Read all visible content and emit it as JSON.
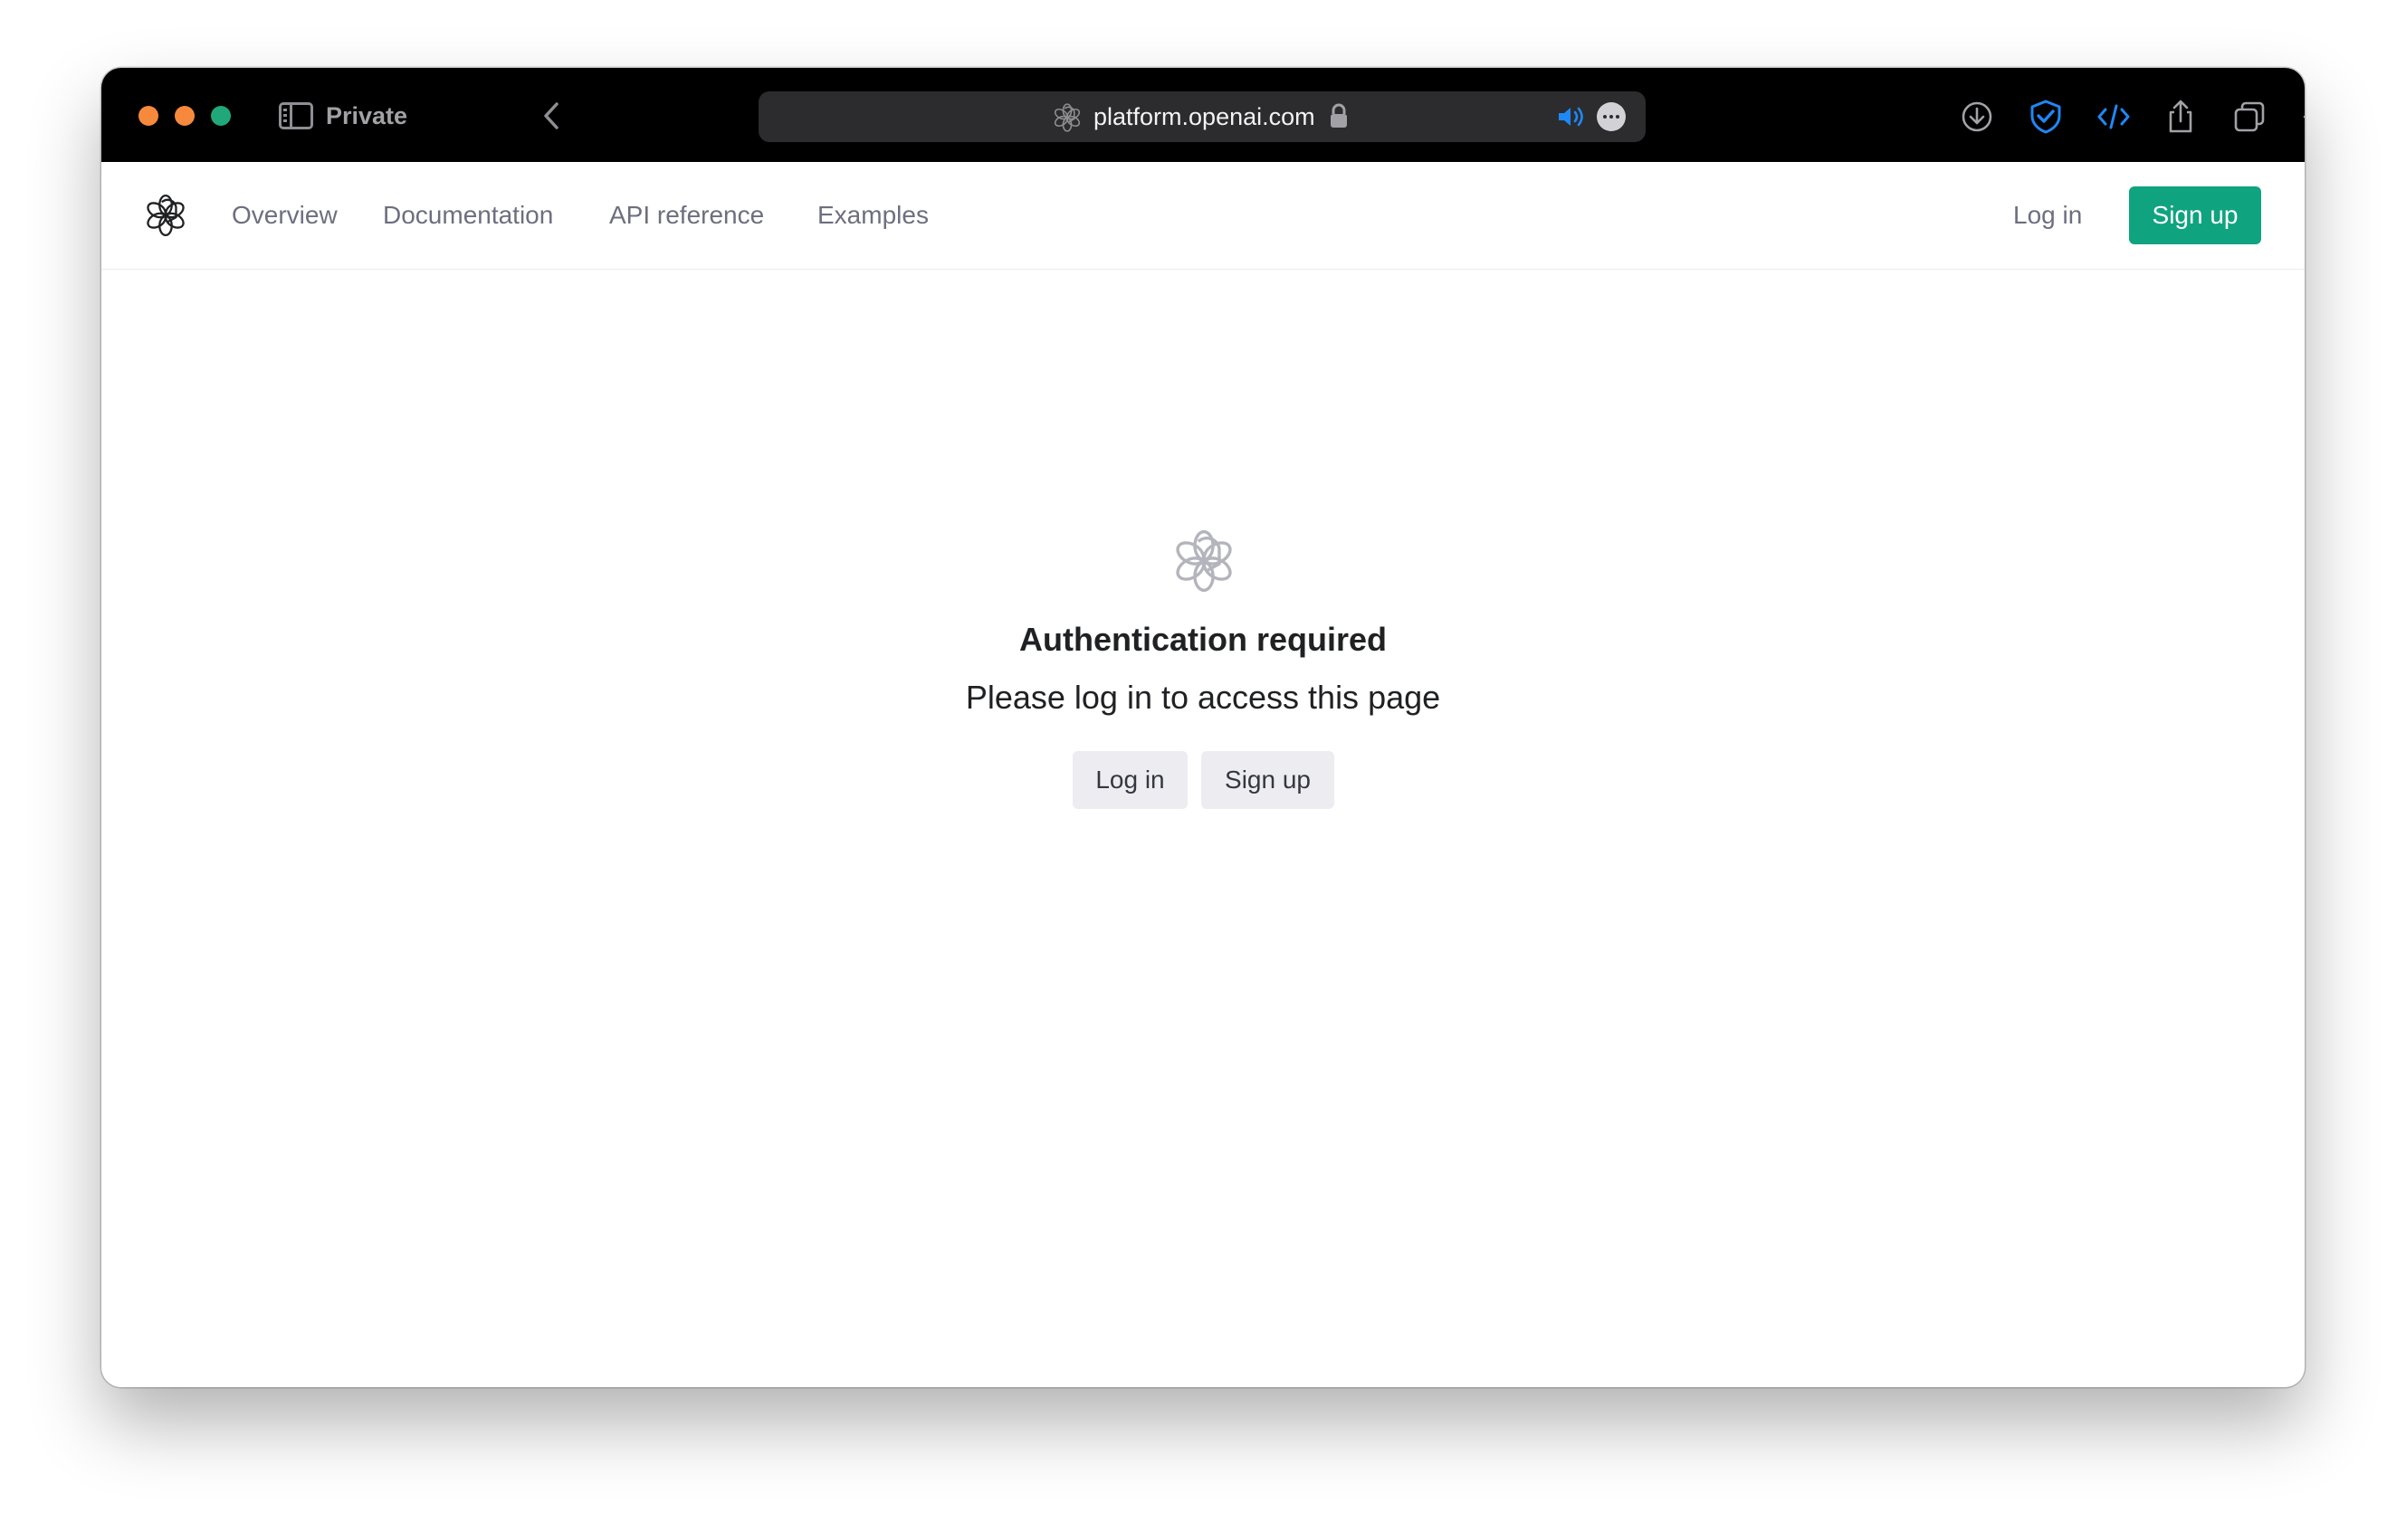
{
  "browser": {
    "mode_label": "Private",
    "url": "platform.openai.com",
    "colors": {
      "close": "#f7893c",
      "minimize": "#f7893c",
      "maximize": "#21a87a",
      "shield": "#1e88f5",
      "dev": "#1e88f5",
      "speaker": "#1e88f5"
    },
    "icons": [
      "sidebar-icon",
      "chevron-left-icon",
      "openai-icon",
      "lock-icon",
      "speaker-icon",
      "ellipsis-icon",
      "download-icon",
      "shield-check-icon",
      "code-icon",
      "share-icon",
      "tabs-icon",
      "plus-icon"
    ]
  },
  "header": {
    "nav": [
      "Overview",
      "Documentation",
      "API reference",
      "Examples"
    ],
    "login_label": "Log in",
    "signup_label": "Sign up",
    "accent_color": "#10a37f"
  },
  "main": {
    "title": "Authentication required",
    "subtitle": "Please log in to access this page",
    "login_button": "Log in",
    "signup_button": "Sign up"
  }
}
